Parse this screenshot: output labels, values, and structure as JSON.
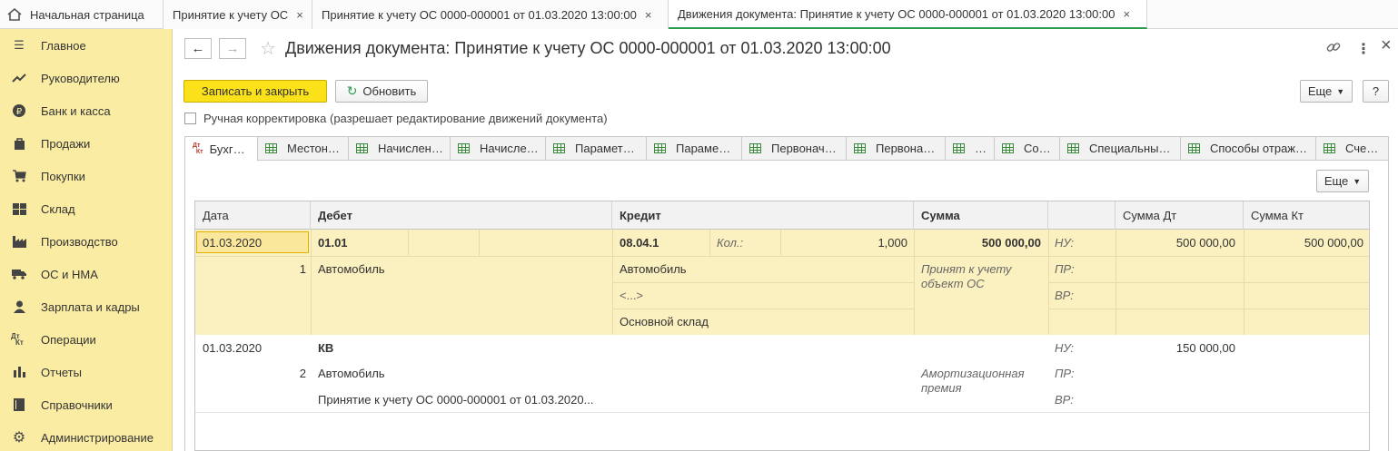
{
  "top_tabs": {
    "home": "Начальная страница",
    "tabs": [
      {
        "label": "Принятие к учету ОС",
        "close": "×"
      },
      {
        "label": "Принятие к учету ОС 0000-000001 от 01.03.2020 13:00:00",
        "close": "×"
      },
      {
        "label": "Движения документа: Принятие к учету ОС 0000-000001 от 01.03.2020 13:00:00",
        "close": "×"
      }
    ]
  },
  "sidebar": {
    "items": [
      {
        "label": "Главное",
        "icon": "menu-icon"
      },
      {
        "label": "Руководителю",
        "icon": "trend-icon"
      },
      {
        "label": "Банк и касса",
        "icon": "ruble-icon"
      },
      {
        "label": "Продажи",
        "icon": "bag-icon"
      },
      {
        "label": "Покупки",
        "icon": "cart-icon"
      },
      {
        "label": "Склад",
        "icon": "warehouse-icon"
      },
      {
        "label": "Производство",
        "icon": "factory-icon"
      },
      {
        "label": "ОС и НМА",
        "icon": "truck-icon"
      },
      {
        "label": "Зарплата и кадры",
        "icon": "person-icon"
      },
      {
        "label": "Операции",
        "icon": "dt-kt-icon"
      },
      {
        "label": "Отчеты",
        "icon": "bar-chart-icon"
      },
      {
        "label": "Справочники",
        "icon": "book-icon"
      },
      {
        "label": "Администрирование",
        "icon": "gear-icon"
      }
    ]
  },
  "header": {
    "back": "←",
    "forward": "→",
    "star": "☆",
    "title": "Движения документа: Принятие к учету ОС 0000-000001 от 01.03.2020 13:00:00",
    "link_icon": "🔗",
    "more_icon": "⋮",
    "close_icon": "×"
  },
  "toolbar": {
    "save_close": "Записать и закрыть",
    "refresh": "Обновить",
    "more": "Еще",
    "help": "?"
  },
  "manual_edit": {
    "label": "Ручная корректировка (разрешает редактирование движений документа)",
    "checked": false
  },
  "register_tabs": [
    {
      "label": "Бухг…",
      "dtkt": "Дт\nКт",
      "active": true
    },
    {
      "label": "Местон…"
    },
    {
      "label": "Начислен…"
    },
    {
      "label": "Начисле…"
    },
    {
      "label": "Парамет…"
    },
    {
      "label": "Параме…"
    },
    {
      "label": "Первонач…"
    },
    {
      "label": "Первона…"
    },
    {
      "label": "…"
    },
    {
      "label": "Со…"
    },
    {
      "label": "Специальны…"
    },
    {
      "label": "Способы отраж…"
    },
    {
      "label": "Сче…"
    }
  ],
  "table_more": "Еще",
  "table": {
    "columns": [
      "Дата",
      "Дебет",
      "Кредит",
      "Сумма",
      "",
      "Сумма Дт",
      "Сумма Кт"
    ],
    "rows": [
      {
        "date": "01.03.2020",
        "num": "1",
        "debit_account": "01.01",
        "debit_sub1": "Автомобиль",
        "credit_account": "08.04.1",
        "qty_label": "Кол.:",
        "qty": "1,000",
        "credit_sub1": "Автомобиль",
        "credit_sub2": "<...>",
        "credit_sub3": "Основной склад",
        "sum": "500 000,00",
        "content": "Принят к учету объект ОС",
        "nu": "НУ:",
        "pr": "ПР:",
        "vr": "ВР:",
        "sum_dt": "500 000,00",
        "sum_kt": "500 000,00"
      },
      {
        "date": "01.03.2020",
        "num": "2",
        "debit_account": "КВ",
        "debit_sub1": "Автомобиль",
        "debit_sub2": "Принятие к учету ОС 0000-000001 от 01.03.2020...",
        "content": "Амортизационная премия",
        "nu": "НУ:",
        "pr": "ПР:",
        "vr": "ВР:",
        "sum_dt": "150 000,00"
      }
    ]
  }
}
